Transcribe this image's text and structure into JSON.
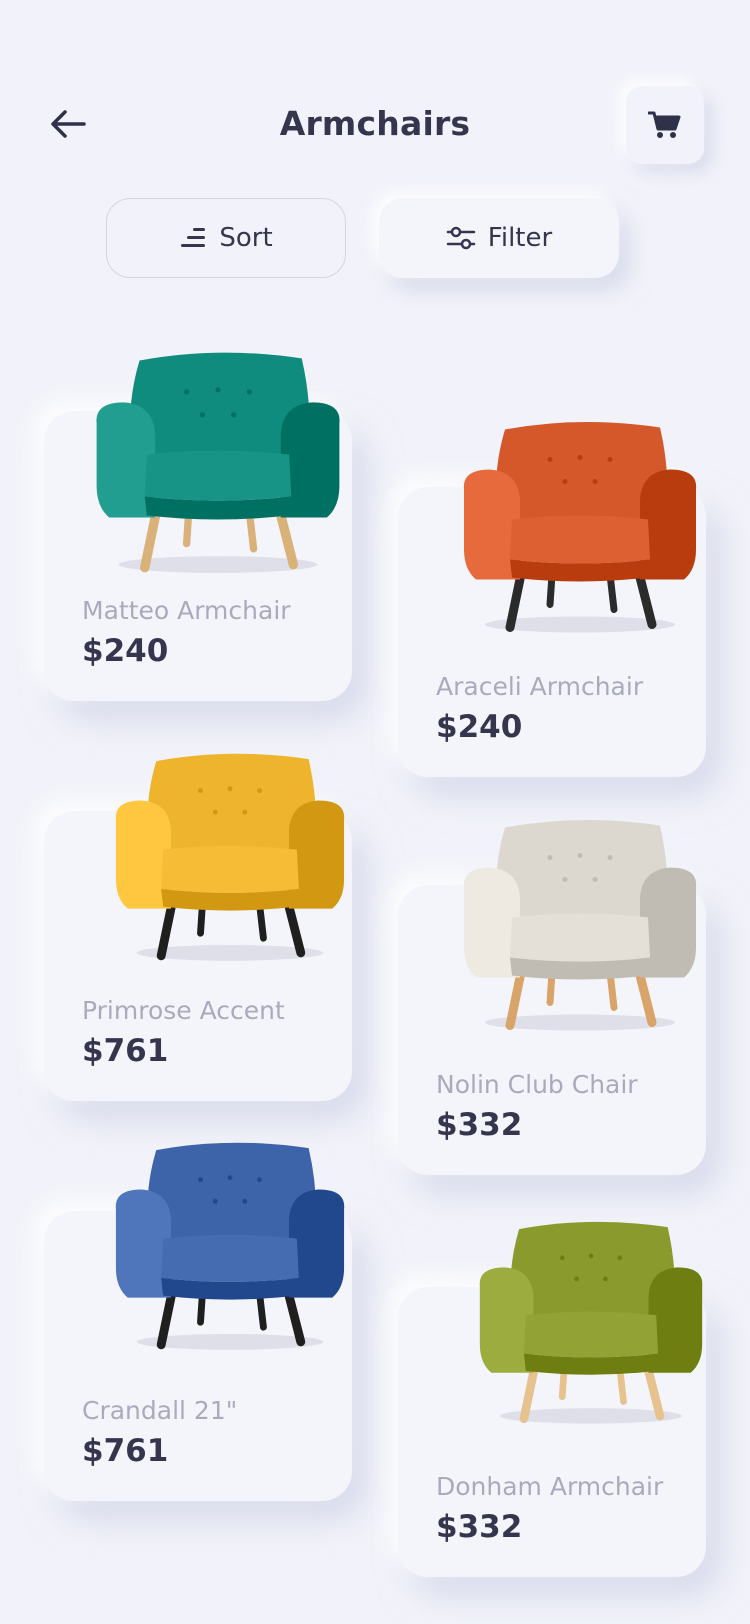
{
  "header": {
    "title": "Armchairs",
    "back_icon": "arrow-left-icon",
    "cart_icon": "cart-icon"
  },
  "toolbar": {
    "sort_label": "Sort",
    "filter_label": "Filter"
  },
  "products": [
    {
      "name": "Matteo Armchair",
      "price": "$240",
      "color": "#0f8c7e",
      "legs": "#d9b27a"
    },
    {
      "name": "Araceli Armchair",
      "price": "$240",
      "color": "#d4582a",
      "legs": "#2b2b2b"
    },
    {
      "name": "Primrose Accent",
      "price": "$761",
      "color": "#efb42d",
      "legs": "#1f1f1f"
    },
    {
      "name": "Nolin Club Chair",
      "price": "$332",
      "color": "#ddd8cf",
      "legs": "#d9a46a"
    },
    {
      "name": "Crandall 21\"",
      "price": "$761",
      "color": "#3d63a8",
      "legs": "#1f1f1f"
    },
    {
      "name": "Donham Armchair",
      "price": "$332",
      "color": "#8a9a2c",
      "legs": "#e6c28f"
    }
  ]
}
